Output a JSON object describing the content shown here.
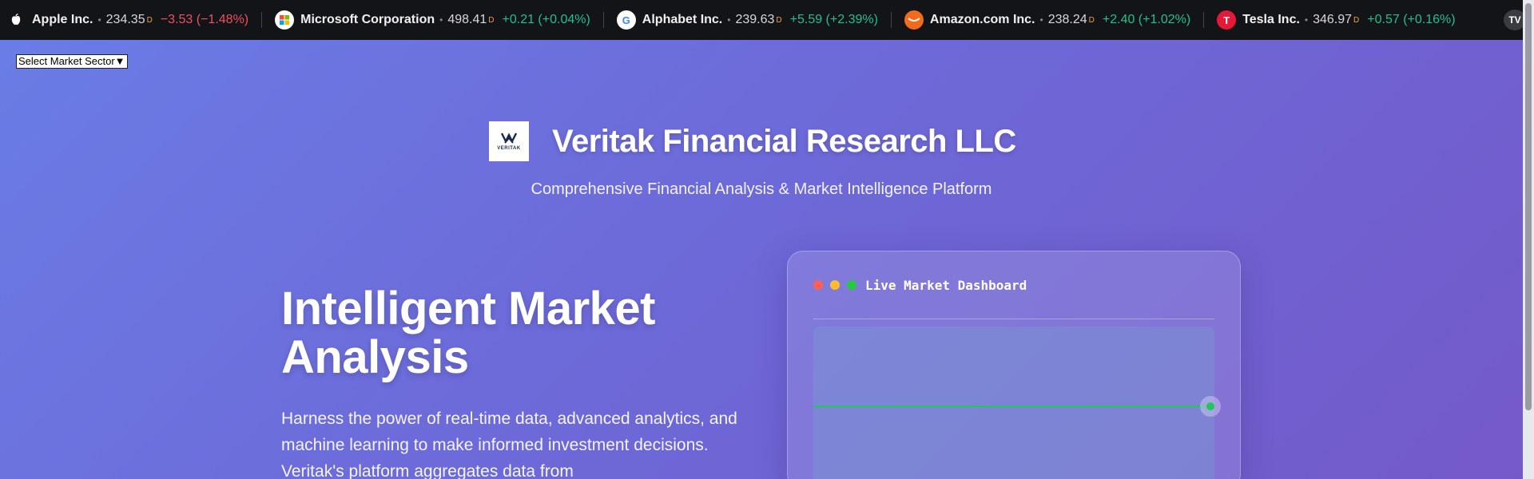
{
  "ticker": {
    "items": [
      {
        "name": "Apple Inc.",
        "price": "234.35",
        "delay": "D",
        "change": "−3.53 (−1.48%)",
        "direction": "down",
        "logo_icon": "apple-icon",
        "logo_text": "",
        "logo_bg": "#131418",
        "logo_color": "#ffffff"
      },
      {
        "name": "Microsoft Corporation",
        "price": "498.41",
        "delay": "D",
        "change": "+0.21 (+0.04%)",
        "direction": "up",
        "logo_icon": "microsoft-icon",
        "logo_text": "",
        "logo_bg": "#ffffff",
        "logo_color": "#000000"
      },
      {
        "name": "Alphabet Inc.",
        "price": "239.63",
        "delay": "D",
        "change": "+5.59 (+2.39%)",
        "direction": "up",
        "logo_icon": "google-icon",
        "logo_text": "G",
        "logo_bg": "#ffffff",
        "logo_color": "#4285f4"
      },
      {
        "name": "Amazon.com Inc.",
        "price": "238.24",
        "delay": "D",
        "change": "+2.40 (+1.02%)",
        "direction": "up",
        "logo_icon": "amazon-icon",
        "logo_text": "",
        "logo_bg": "#f26b1d",
        "logo_color": "#ffffff"
      },
      {
        "name": "Tesla Inc.",
        "price": "346.97",
        "delay": "D",
        "change": "+0.57 (+0.16%)",
        "direction": "up",
        "logo_icon": "tesla-icon",
        "logo_text": "T",
        "logo_bg": "#e31937",
        "logo_color": "#ffffff"
      }
    ],
    "badge": "TV"
  },
  "sector_select": {
    "label": "Select Market Sector▼"
  },
  "header": {
    "logo_text": "VERITAK",
    "title": "Veritak Financial Research LLC",
    "tagline": "Comprehensive Financial Analysis & Market Intelligence Platform"
  },
  "hero": {
    "title": "Intelligent Market Analysis",
    "description": "Harness the power of real-time data, advanced analytics, and machine learning to make informed investment decisions. Veritak's platform aggregates data from"
  },
  "dashboard": {
    "title": "Live Market Dashboard",
    "window_dots": [
      "#ff5f57",
      "#febc2e",
      "#28c840"
    ],
    "line_color": "#22c55e"
  },
  "colors": {
    "accent_up": "#22c08a",
    "accent_down": "#ef4f5f"
  }
}
